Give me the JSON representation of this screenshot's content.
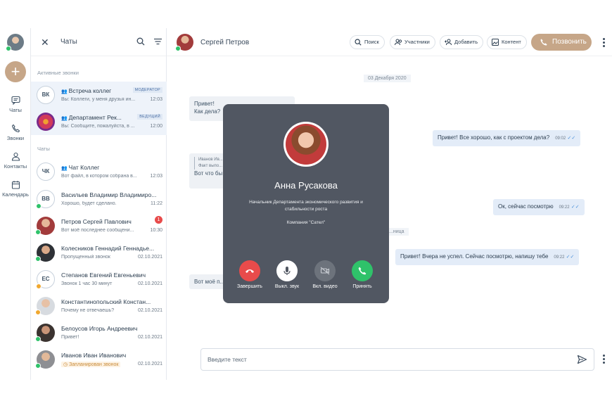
{
  "nav": {
    "items": [
      {
        "label": "Чаты",
        "icon": "chat-icon"
      },
      {
        "label": "Звонки",
        "icon": "phone-icon"
      },
      {
        "label": "Контакты",
        "icon": "contacts-icon"
      },
      {
        "label": "Календарь",
        "icon": "calendar-icon"
      }
    ],
    "add_icon": "+"
  },
  "chatlist": {
    "title": "Чаты",
    "section_active": "Активные звонки",
    "section_chats": "Чаты",
    "active": [
      {
        "initials": "ВК",
        "name": "Встреча коллег",
        "preview": "Вы: Коллеги, у меня друзья ин...",
        "time": "12:03",
        "role": "МОДЕРАТОР"
      },
      {
        "initials": "",
        "name": "Департамент Рек...",
        "preview": "Вы: Сообщите, пожалуйста, в ...",
        "time": "12:00",
        "role": "ВЕДУЩИЙ"
      }
    ],
    "chats": [
      {
        "initials": "ЧК",
        "name": "Чат Коллег",
        "preview": "Вот файл, в котором собрана в...",
        "time": "12:03"
      },
      {
        "initials": "ВВ",
        "name": "Васильев Владимир Владимиро...",
        "preview": "Хорошо, будет сделано.",
        "time": "11:22"
      },
      {
        "initials": "",
        "name": "Петров Сергей Павлович",
        "preview": "Вот моё последнее сообщени...",
        "time": "10:30",
        "unread": "1"
      },
      {
        "initials": "",
        "name": "Колесников Геннадий Геннадье...",
        "preview": "Пропущенный звонок",
        "time": "02.10.2021"
      },
      {
        "initials": "ЕС",
        "name": "Степанов Евгений Евгеньевич",
        "preview": "Звонок 1 час 30 минут",
        "time": "02.10.2021"
      },
      {
        "initials": "",
        "name": "Константинопольский Констан...",
        "preview": "Почему не отвечаешь?",
        "time": "02.10.2021"
      },
      {
        "initials": "",
        "name": "Белоусов Игорь Андреевич",
        "preview": "Привет!",
        "time": "02.10.2021"
      },
      {
        "initials": "",
        "name": "Иванов Иван Иванович",
        "preview": "Запланирован звонок",
        "time": "02.10.2021"
      }
    ]
  },
  "header": {
    "name": "Сергей Петров",
    "search": "Поиск",
    "participants": "Участники",
    "add": "Добавить",
    "content": "Контент",
    "call": "Позвонить"
  },
  "messages": {
    "date": "03 Декабря 2020",
    "m1": "Привет!",
    "m2": "Как дела?",
    "m3_quote1": "Иванов Ив...",
    "m3_quote2": "Факт выпо...",
    "m3": "Вот что бы...",
    "o1": "Привет! Все хорошо, как с проектом дела?",
    "o1_time": "09:02",
    "o2": "Ок, сейчас посмотрю",
    "o2_time": "09:22",
    "o3": "Привет! Вчера не успел. Сейчас посмотрю, напишу тебе",
    "o3_time": "09:22",
    "m4": "Вот моё п...",
    "frag": "...ница"
  },
  "input": {
    "placeholder": "Введите текст"
  },
  "call_overlay": {
    "name": "Анна Русакова",
    "position": "Начальник Департамента экономического развития и стабильности роста",
    "company": "Компания \"Сател\"",
    "buttons": {
      "end": "Завершить",
      "mute": "Выкл. звук",
      "video": "Вкл. видео",
      "accept": "Принять"
    },
    "colors": {
      "end": "#e84b4b",
      "mute": "#ffffff",
      "video": "#6d737c",
      "accept": "#2fc26a"
    }
  }
}
